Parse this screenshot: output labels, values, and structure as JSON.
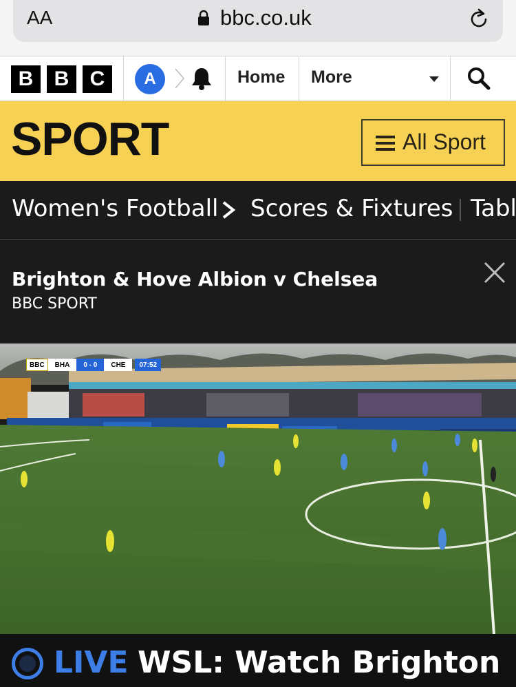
{
  "browser": {
    "text_size_label": "AA",
    "url": "bbc.co.uk"
  },
  "bbc_nav": {
    "logo_letters": [
      "B",
      "B",
      "C"
    ],
    "account_initial": "A",
    "home_label": "Home",
    "more_label": "More"
  },
  "sport": {
    "title": "SPORT",
    "all_sport_label": "All Sport"
  },
  "secondary_nav": {
    "items": [
      "Women's Football",
      "Scores & Fixtures",
      "Tabl"
    ]
  },
  "media": {
    "title": "Brighton & Hove Albion v Chelsea",
    "source": "BBC SPORT"
  },
  "scorebug": {
    "broadcaster": "BBC",
    "home_team": "BHA",
    "score": "0 - 0",
    "away_team": "CHE",
    "clock": "07:52"
  },
  "live": {
    "badge": "LIVE",
    "title": "WSL: Watch Brighton"
  },
  "colors": {
    "sport_yellow": "#f6d154",
    "live_blue": "#3c7de6",
    "account_blue": "#2a6ce1"
  }
}
